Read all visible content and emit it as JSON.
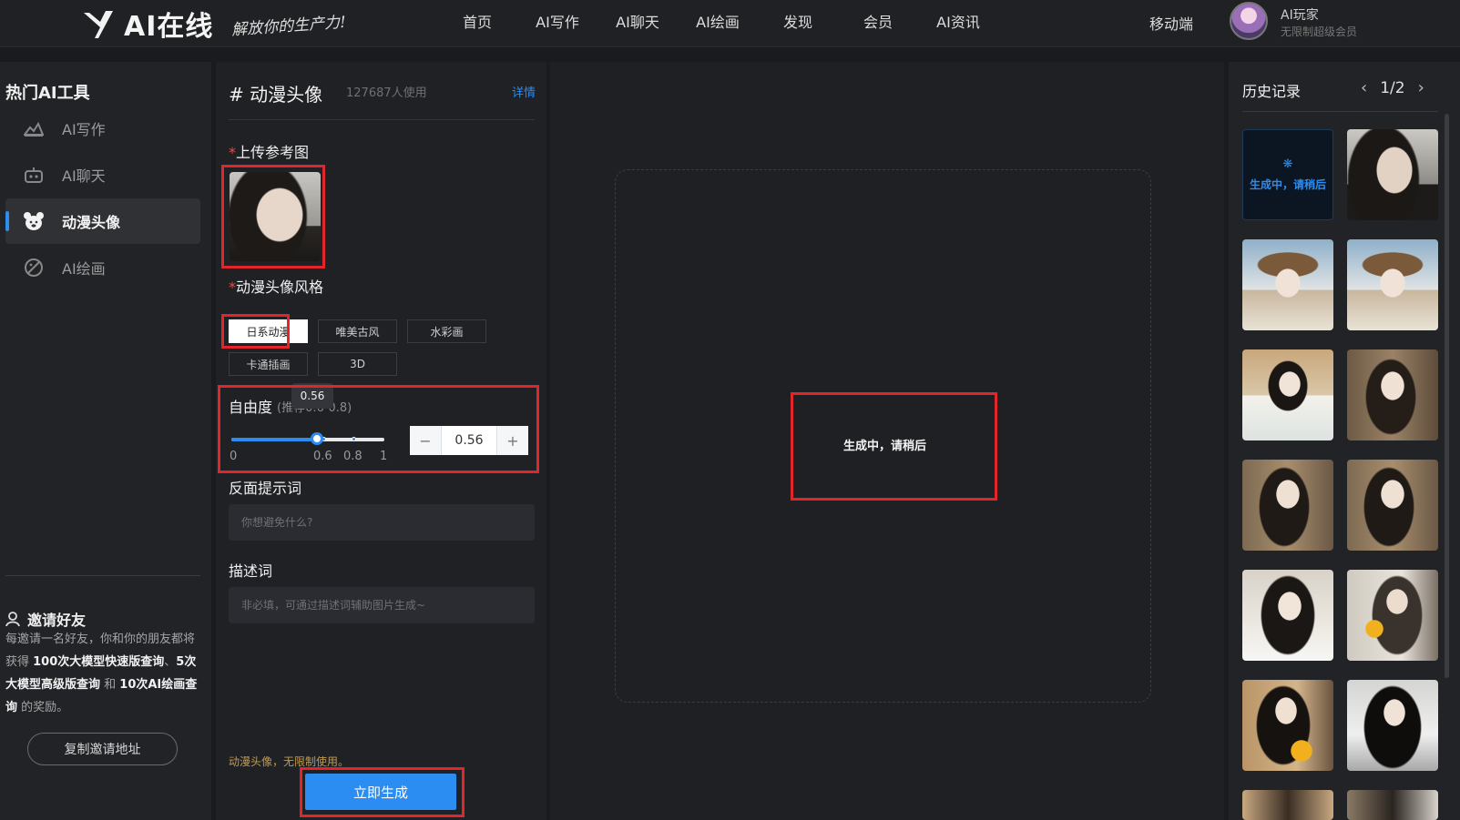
{
  "header": {
    "logo_text": "AI在线",
    "slogan": "解放你的生产力!",
    "nav": [
      "首页",
      "AI写作",
      "AI聊天",
      "AI绘画",
      "发现",
      "会员",
      "AI资讯"
    ],
    "mobile": "移动端",
    "user_name": "AI玩家",
    "user_level": "无限制超级会员"
  },
  "sidebar": {
    "title": "热门AI工具",
    "items": [
      {
        "label": "AI写作",
        "icon": "writing-icon"
      },
      {
        "label": "AI聊天",
        "icon": "robot-icon"
      },
      {
        "label": "动漫头像",
        "icon": "bear-icon",
        "active": true
      },
      {
        "label": "AI绘画",
        "icon": "paint-icon"
      }
    ],
    "invite_title": "邀请好友",
    "invite_text_1": "每邀请一名好友，你和你的朋友都将获得 ",
    "invite_bold_1": "100次大模型快速版查询",
    "invite_text_2": "、",
    "invite_bold_2": "5次大模型高级版查询",
    "invite_text_3": " 和 ",
    "invite_bold_3": "10次AI绘画查询",
    "invite_text_4": " 的奖励。",
    "copy_button": "复制邀请地址"
  },
  "form": {
    "title": "# 动漫头像",
    "users": "127687人使用",
    "detail_link": "详情",
    "upload_label": "上传参考图",
    "required_mark": "*",
    "style_label": "动漫头像风格",
    "styles": [
      "日系动漫",
      "唯美古风",
      "水彩画",
      "卡通插画",
      "3D"
    ],
    "selected_style": "日系动漫",
    "freedom_label": "自由度",
    "freedom_hint": "(推荐0.6-0.8)",
    "freedom_value": "0.56",
    "freedom_fraction": 0.56,
    "slider_ticks": [
      "0",
      "0.6",
      "0.8",
      "1"
    ],
    "negative_label": "反面提示词",
    "negative_placeholder": "你想避免什么?",
    "desc_label": "描述词",
    "desc_placeholder": "非必填，可通过描述词辅助图片生成~",
    "footer_note": "动漫头像，无限制使用。",
    "generate_button": "立即生成"
  },
  "canvas": {
    "status_text": "生成中，请稍后"
  },
  "history": {
    "title": "历史记录",
    "page": "1/2",
    "pending_text": "生成中，请稍后"
  },
  "colors": {
    "accent": "#2b8cf2",
    "highlight_border": "#e0262b",
    "background": "#1a1b1e"
  }
}
